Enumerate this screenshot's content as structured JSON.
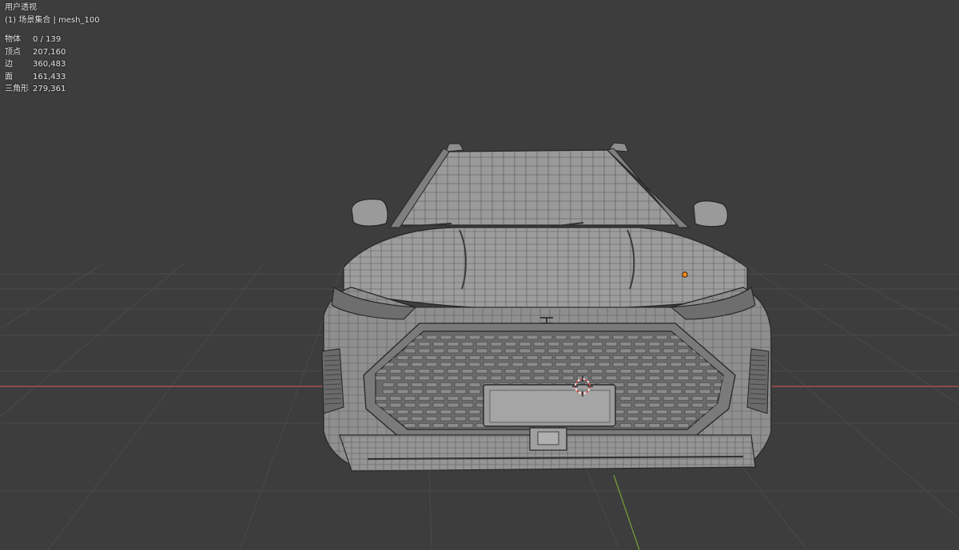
{
  "viewport": {
    "view_name": "用户透视",
    "collection_line": "(1) 场景集合 | mesh_100",
    "background_color": "#3d3d3d",
    "grid_color": "#4a4a4a",
    "x_axis_color": "#b85454",
    "y_axis_color": "#7ba03a",
    "stats": [
      {
        "label": "物体",
        "value": "0 / 139"
      },
      {
        "label": "顶点",
        "value": "207,160"
      },
      {
        "label": "边",
        "value": "360,483"
      },
      {
        "label": "面",
        "value": "161,433"
      },
      {
        "label": "三角形",
        "value": "279,361"
      }
    ]
  },
  "scene": {
    "object": "car-mesh-wireframe",
    "icons": [
      "3d-cursor-icon",
      "origin-point-icon"
    ]
  }
}
